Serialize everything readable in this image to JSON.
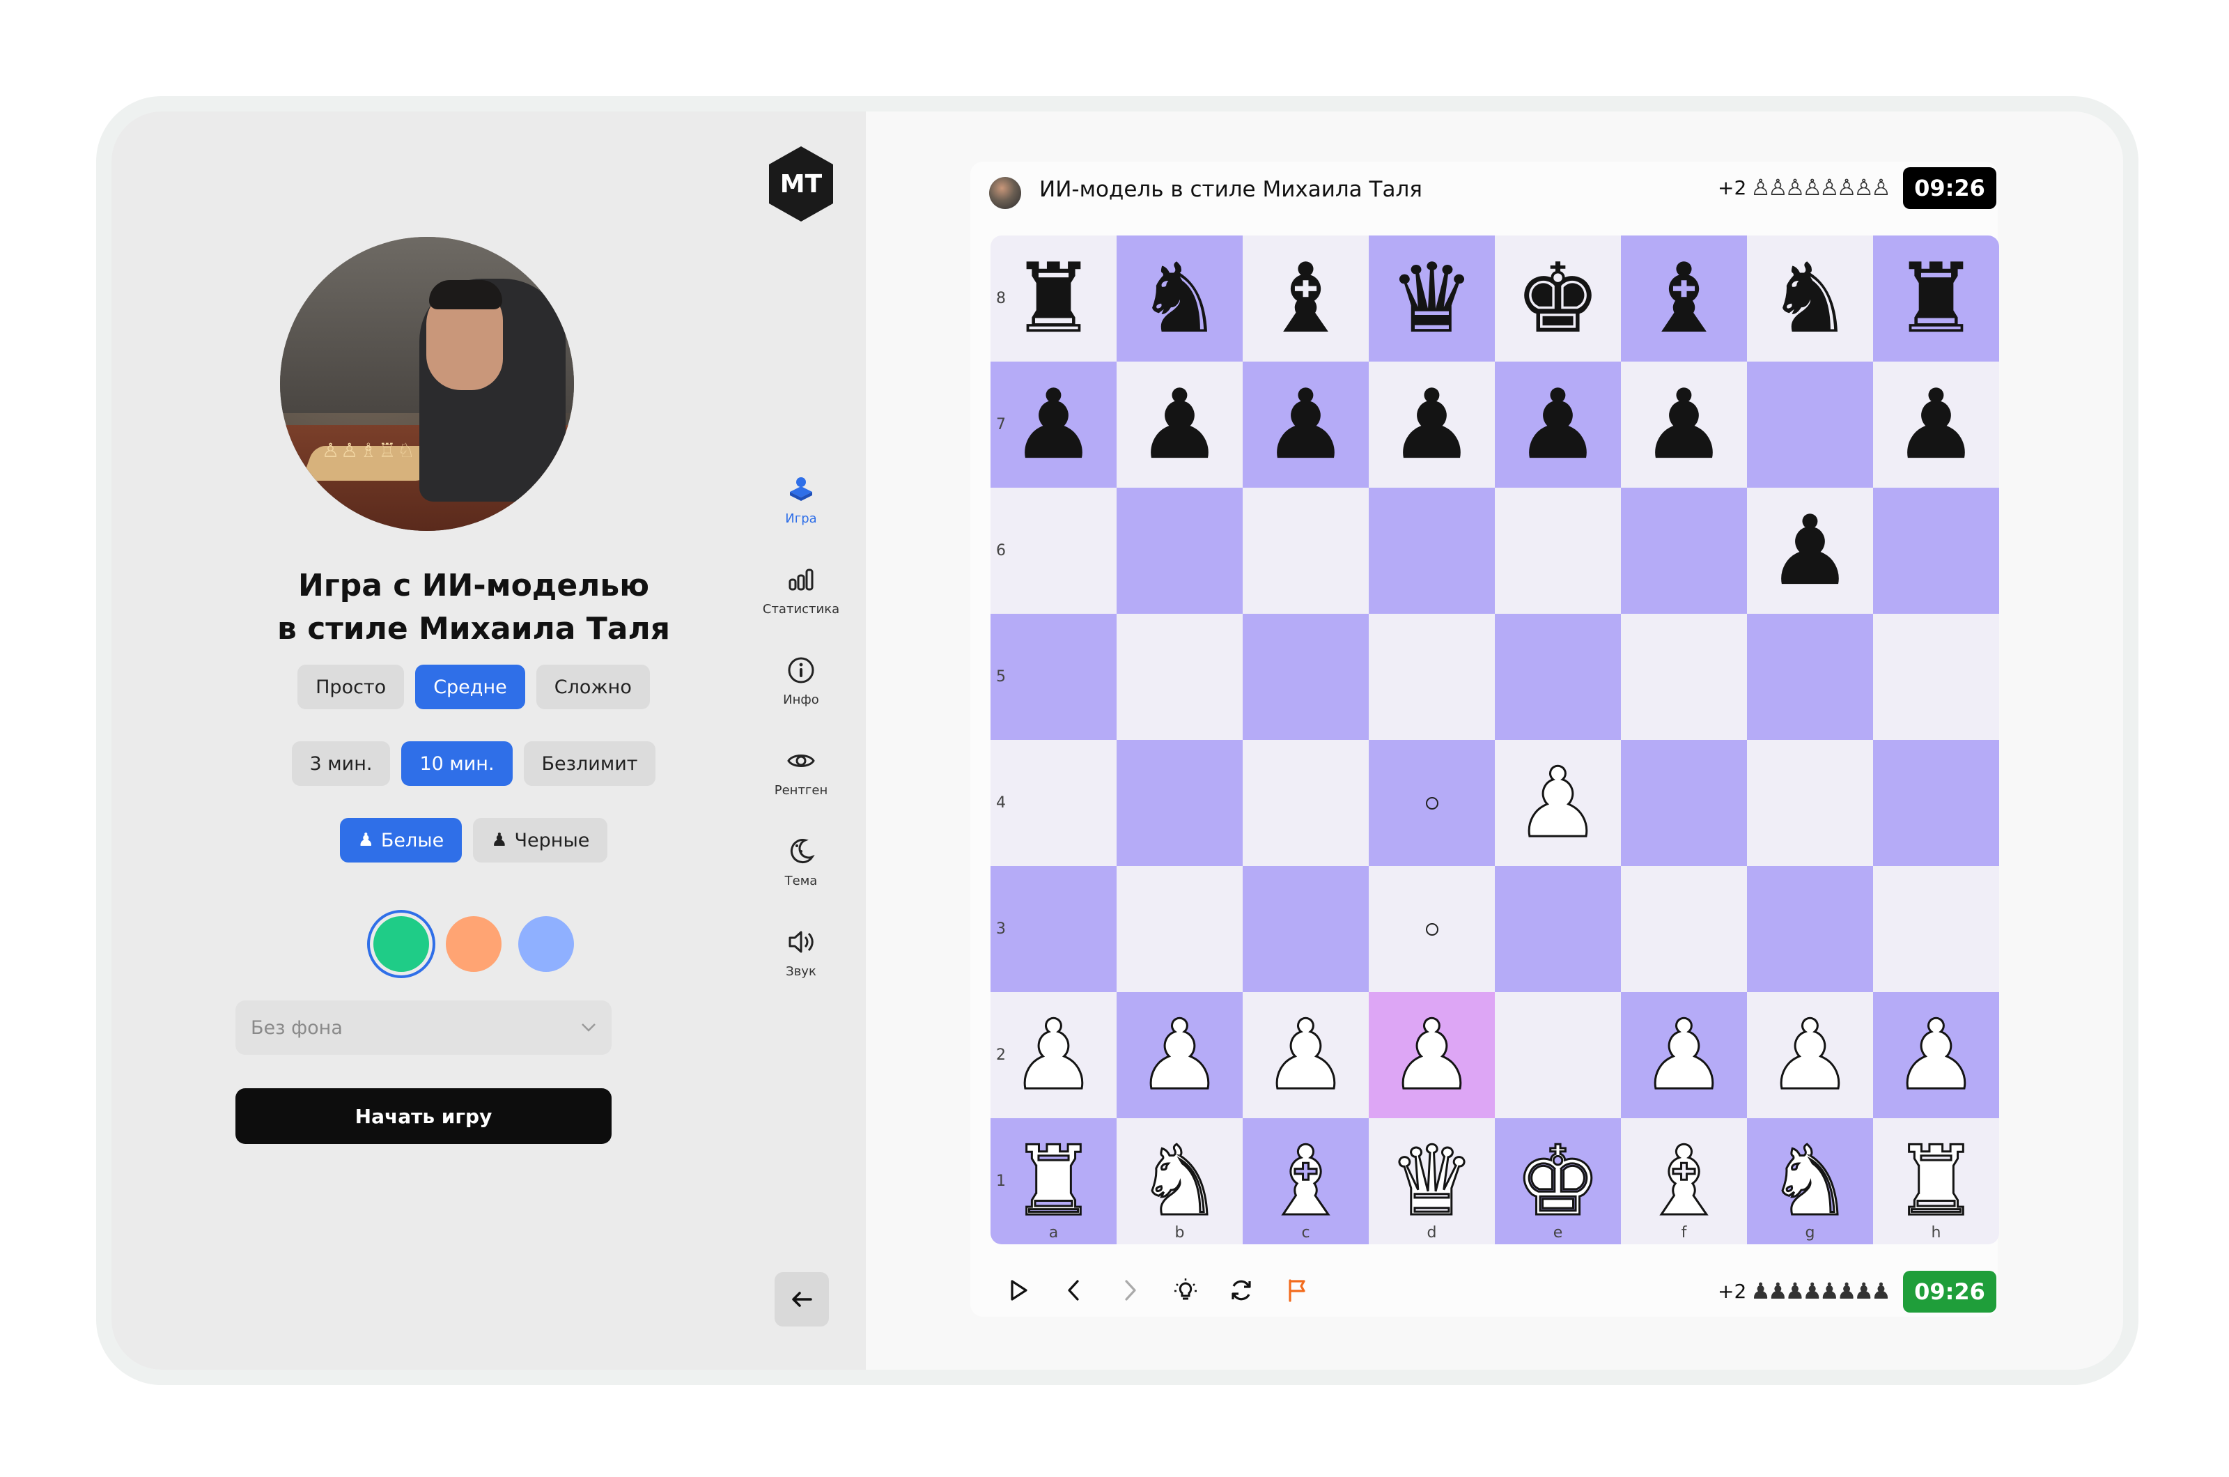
{
  "setup": {
    "title_line1": "Игра с ИИ-моделью",
    "title_line2": "в стиле Михаила Таля",
    "difficulty": [
      {
        "label": "Просто",
        "active": false
      },
      {
        "label": "Средне",
        "active": true
      },
      {
        "label": "Сложно",
        "active": false
      }
    ],
    "time_control": [
      {
        "label": "3 мин.",
        "active": false
      },
      {
        "label": "10 мин.",
        "active": true
      },
      {
        "label": "Безлимит",
        "active": false
      }
    ],
    "side": [
      {
        "label": "Белые",
        "icon": "pawn-icon",
        "active": true
      },
      {
        "label": "Черные",
        "icon": "pawn-icon",
        "active": false
      }
    ],
    "board_colors": [
      "#1fcc87",
      "#ffa473",
      "#8fb0ff"
    ],
    "selected_color": 0,
    "background_select": "Без фона",
    "start_button": "Начать игру"
  },
  "nav": {
    "logo": "MT",
    "items": [
      {
        "label": "Игра",
        "icon": "game-icon",
        "active": true
      },
      {
        "label": "Статистика",
        "icon": "stats-icon",
        "active": false
      },
      {
        "label": "Инфо",
        "icon": "info-icon",
        "active": false
      },
      {
        "label": "Рентген",
        "icon": "eye-icon",
        "active": false
      },
      {
        "label": "Тема",
        "icon": "theme-icon",
        "active": false
      },
      {
        "label": "Звук",
        "icon": "sound-icon",
        "active": false
      }
    ]
  },
  "opponent": {
    "name": "ИИ-модель в стиле Михаила Таля",
    "material": "+2",
    "captured": "♙♙♙♙♙♙♙♙",
    "clock": "09:26",
    "clock_color": "#000000"
  },
  "player": {
    "material": "+2",
    "captured": "♟♟♟♟♟♟♟♟",
    "clock": "09:26",
    "clock_color": "#1f9e3a"
  },
  "board": {
    "ranks": [
      "8",
      "7",
      "6",
      "5",
      "4",
      "3",
      "2",
      "1"
    ],
    "files": [
      "a",
      "b",
      "c",
      "d",
      "e",
      "f",
      "g",
      "h"
    ],
    "position": [
      [
        "r",
        "n",
        "b",
        "q",
        "k",
        "b",
        "n",
        "r"
      ],
      [
        "p",
        "p",
        "p",
        "p",
        "p",
        "p",
        "",
        "p"
      ],
      [
        "",
        "",
        "",
        "",
        "",
        "",
        "p",
        ""
      ],
      [
        "",
        "",
        "",
        "",
        "",
        "",
        "",
        ""
      ],
      [
        "",
        "",
        "",
        "",
        "P",
        "",
        "",
        ""
      ],
      [
        "",
        "",
        "",
        "",
        "",
        "",
        "",
        ""
      ],
      [
        "P",
        "P",
        "P",
        "P",
        "",
        "P",
        "P",
        "P"
      ],
      [
        "R",
        "N",
        "B",
        "Q",
        "K",
        "B",
        "N",
        "R"
      ]
    ],
    "highlight": [
      "d2"
    ],
    "move_hints": [
      "d4",
      "d3"
    ]
  },
  "toolbar": [
    "play-icon",
    "prev-icon",
    "next-icon",
    "hint-icon",
    "flip-icon",
    "resign-flag-icon"
  ]
}
